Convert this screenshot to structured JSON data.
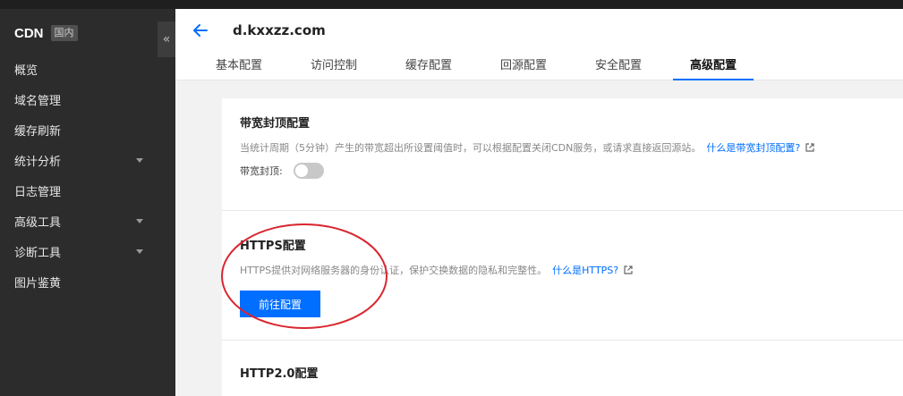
{
  "app": {
    "brand": "CDN",
    "region_tag": "国内",
    "collapse_glyph": "«"
  },
  "sidebar": {
    "items": [
      {
        "label": "概览",
        "has_caret": false
      },
      {
        "label": "域名管理",
        "has_caret": false
      },
      {
        "label": "缓存刷新",
        "has_caret": false
      },
      {
        "label": "统计分析",
        "has_caret": true
      },
      {
        "label": "日志管理",
        "has_caret": false
      },
      {
        "label": "高级工具",
        "has_caret": true
      },
      {
        "label": "诊断工具",
        "has_caret": true
      },
      {
        "label": "图片鉴黄",
        "has_caret": false
      }
    ]
  },
  "header": {
    "domain": "d.kxxzz.com",
    "tabs": [
      {
        "label": "基本配置",
        "active": false
      },
      {
        "label": "访问控制",
        "active": false
      },
      {
        "label": "缓存配置",
        "active": false
      },
      {
        "label": "回源配置",
        "active": false
      },
      {
        "label": "安全配置",
        "active": false
      },
      {
        "label": "高级配置",
        "active": true
      }
    ]
  },
  "sections": {
    "bandwidth": {
      "title": "带宽封顶配置",
      "desc": "当统计周期（5分钟）产生的带宽超出所设置阈值时，可以根据配置关闭CDN服务，或请求直接返回源站。",
      "link": "什么是带宽封顶配置?",
      "toggle_label": "带宽封顶:",
      "toggle_on": false
    },
    "https": {
      "title": "HTTPS配置",
      "desc": "HTTPS提供对网络服务器的身份认证，保护交换数据的隐私和完整性。",
      "link": "什么是HTTPS?",
      "button": "前往配置"
    },
    "http2": {
      "title": "HTTP2.0配置"
    }
  },
  "colors": {
    "accent": "#006eff",
    "annotation": "#d9262f",
    "sidebar_bg": "#2c2c2c"
  }
}
